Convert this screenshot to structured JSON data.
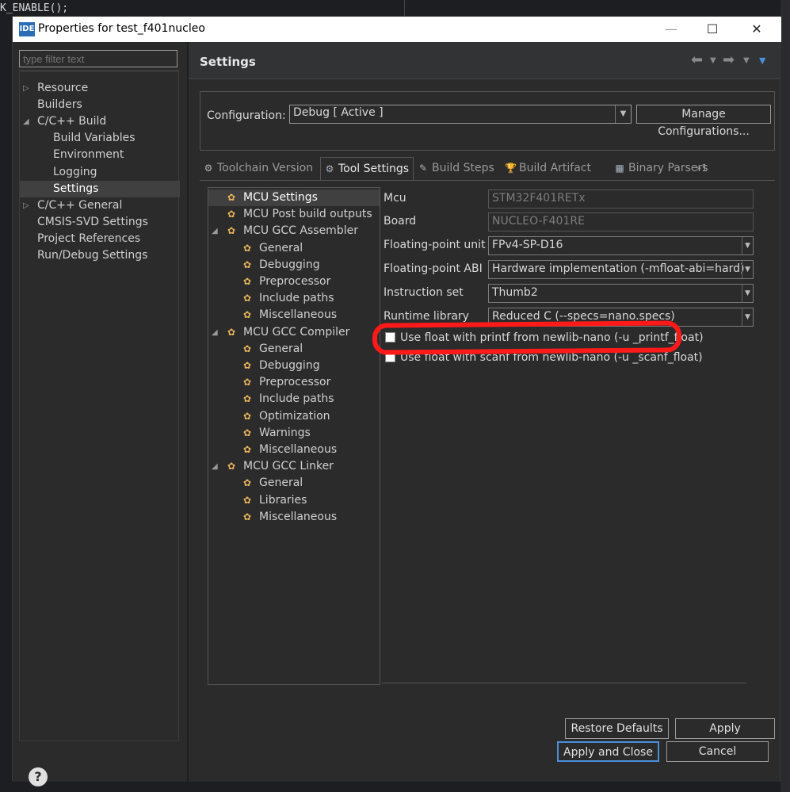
{
  "background": {
    "top_code": "K_ENABLE();"
  },
  "window": {
    "icon_label": "IDE",
    "title": "Properties for test_f401nucleo",
    "minimize": "—",
    "maximize": "☐",
    "close": "✕"
  },
  "left": {
    "filter_placeholder": "type filter text",
    "items": [
      {
        "label": "Resource",
        "twisty": "▷"
      },
      {
        "label": "Builders"
      },
      {
        "label": "C/C++ Build",
        "twisty": "◢"
      },
      {
        "label": "Build Variables"
      },
      {
        "label": "Environment"
      },
      {
        "label": "Logging"
      },
      {
        "label": "Settings"
      },
      {
        "label": "C/C++ General",
        "twisty": "▷"
      },
      {
        "label": "CMSIS-SVD Settings"
      },
      {
        "label": "Project References"
      },
      {
        "label": "Run/Debug Settings"
      }
    ],
    "help": "?"
  },
  "settings": {
    "title": "Settings",
    "config_label": "Configuration:",
    "config_value": "Debug  [ Active ]",
    "manage_label": "Manage Configurations...",
    "tabs": [
      {
        "label": "Toolchain  Version"
      },
      {
        "label": "Tool Settings"
      },
      {
        "label": "Build Steps"
      },
      {
        "label": "Build Artifact"
      },
      {
        "label": "Binary Parsers"
      },
      {
        "label": "»1"
      }
    ],
    "tree": [
      {
        "label": "MCU Settings"
      },
      {
        "label": "MCU Post build outputs"
      },
      {
        "label": "MCU GCC Assembler",
        "twisty": "◢"
      },
      {
        "label": "General"
      },
      {
        "label": "Debugging"
      },
      {
        "label": "Preprocessor"
      },
      {
        "label": "Include paths"
      },
      {
        "label": "Miscellaneous"
      },
      {
        "label": "MCU GCC Compiler",
        "twisty": "◢"
      },
      {
        "label": "General"
      },
      {
        "label": "Debugging"
      },
      {
        "label": "Preprocessor"
      },
      {
        "label": "Include paths"
      },
      {
        "label": "Optimization"
      },
      {
        "label": "Warnings"
      },
      {
        "label": "Miscellaneous"
      },
      {
        "label": "MCU GCC Linker",
        "twisty": "◢"
      },
      {
        "label": "General"
      },
      {
        "label": "Libraries"
      },
      {
        "label": "Miscellaneous"
      }
    ],
    "props": [
      {
        "label": "Mcu",
        "value": "STM32F401RETx"
      },
      {
        "label": "Board",
        "value": "NUCLEO-F401RE"
      },
      {
        "label": "Floating-point unit",
        "value": "FPv4-SP-D16"
      },
      {
        "label": "Floating-point ABI",
        "value": "Hardware implementation (-mfloat-abi=hard)"
      },
      {
        "label": "Instruction set",
        "value": "Thumb2"
      },
      {
        "label": "Runtime library",
        "value": "Reduced C (--specs=nano.specs)"
      }
    ],
    "checks": [
      {
        "label": "Use float with printf from newlib-nano (-u _printf_float)"
      },
      {
        "label": "Use float with scanf from newlib-nano (-u _scanf_float)"
      }
    ],
    "restore_label": "Restore Defaults",
    "apply_label": "Apply"
  },
  "footer": {
    "apply_close_label": "Apply and Close",
    "cancel_label": "Cancel"
  },
  "colors": {
    "highlight_red": "#ff1a1a",
    "default_button_border": "#4a8fd8"
  }
}
